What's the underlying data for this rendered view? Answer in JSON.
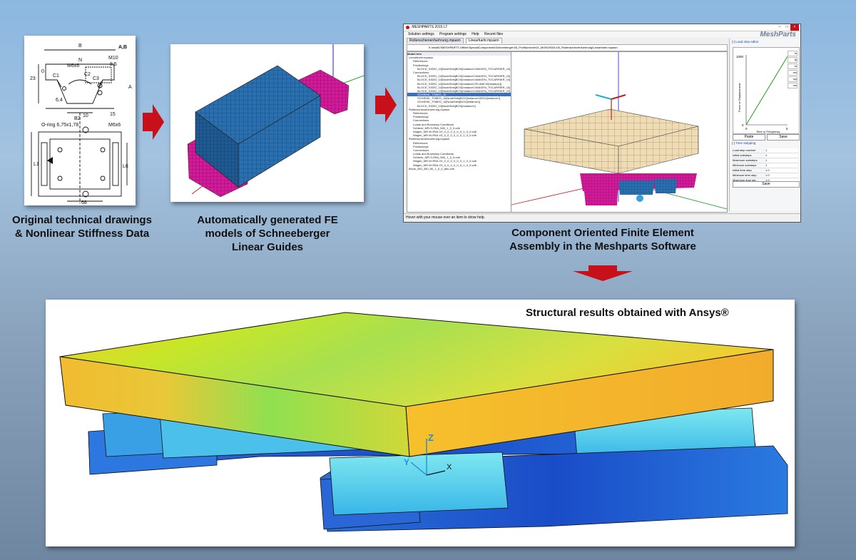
{
  "captions": {
    "drawings": [
      "Original technical drawings",
      "& Nonlinear Stiffness Data"
    ],
    "fe_models": [
      "Automatically generated FE",
      "models of Schneeberger",
      "Linear Guides"
    ],
    "assembly": [
      "Component Oriented Finite Element",
      "Assembly in the Meshparts Software"
    ],
    "results": "Structural results obtained with Ansys®"
  },
  "drawing": {
    "labels": [
      "B",
      "N",
      "A,B",
      "M10",
      "8,5",
      "M6x6",
      "23",
      "A",
      "0",
      "C1",
      "C2",
      "C3",
      "B2",
      "15",
      "6,4",
      "O-ring 6,75x1,78",
      "10",
      "M6x6",
      "L1",
      "L6",
      "68"
    ]
  },
  "meshparts_window": {
    "title": "MESHPARTS 2015 LT",
    "menu": [
      "Solution settings",
      "Program settings",
      "Help",
      "Recent files"
    ],
    "tabs": [
      "Rollenschienenfuehrung.mpasm",
      "Linearfuehr.mpasm"
    ],
    "path": "K:\\retail\\7\\MESHPARTS-Offline\\SpecialComponents\\Schneeberger\\05_Profilschiene\\01_MONORAIL\\05_Rollenschienenfuehrung\\Linearfuehr.mpasm",
    "logo": "MeshParts",
    "model_tree_title": "Model tree",
    "tree_items": [
      "Linearfuehr.mpasm",
      "References",
      "Positionings",
      "BLOCK_SIDE2_10[NodeSets]BOX[Instance1\\WAGEN_TOCARRIER_10]",
      "Connections",
      "BLOCK_SIDE2_10[NodeSets]BOX[Instance1\\WAGEN_TOCARRIER_10]",
      "BLOCK_SIDE2_10[NodeSets]BOX[Instance1\\WAGEN_TOCARRIER_10]",
      "BLOCK_SIDE2_10[NodeSets]BOX[Instance1\\PLANE10[Instance]]",
      "BLOCK_SIDE2_10[NodeSets]BOX[Instance1\\WAGEN_TOCARRIER_10]",
      "BLOCK_SIDE2_10[NodeSets]BOX[Instance1\\WAGEN_TOCARRIER_10]",
      "SCHIENE_TOBED_10",
      "SCHIENE_TOBED_10[NodeSets]BOX[Instance1\\BOX[Instance1]",
      "SCHIENE_TOBED_10[NodeSets]BOX[Instance1]",
      "BLOCK_SIDE2_10[NodeSets]BOX[Instance1]",
      "Rollenschienenfuehrung.mpasm",
      "References",
      "Positionings",
      "Connections",
      "Loads and Boundary Conditions",
      "Schiene_MR-S-R5A_560_1_0_0.cdb",
      "Wagen_MR-W-R5A-V3_0_0_0_0_0_0_1_0_0.cdb",
      "Wagen_MR-W-R5A-V3_0_0_0_0_0_0_1_0_0.cdb",
      "Rollenschienenfuehrung.mpasm",
      "References",
      "Positionings",
      "Connections",
      "Loads and Boundary Conditions",
      "Schiene_MR-S-R5A_560_1_0_0.cdb",
      "Wagen_MR-W-R5A-V3_0_0_0_0_0_0_1_0_0.cdb",
      "Wagen_MR-W-R5A-V3_0_0_0_0_0_0_1_0_0.cdb",
      "Block_450_450_50_1_0_0_abc.cdb"
    ],
    "load_step_editor": "[-] Load step editor",
    "plot": {
      "ymax": "1000",
      "ylabel": "Force or Displacement",
      "xlabel": "Time or Frequency",
      "xmin": "0",
      "xmax": "5",
      "ymin": "0"
    },
    "legend_items": [
      "fx",
      "fy",
      "fz",
      "mx",
      "my",
      "mz"
    ],
    "buttons": {
      "paste": "Paste",
      "save": "Save",
      "save2": "Save"
    },
    "time_stepping": "[-] Time stepping",
    "settings": [
      {
        "label": "Load step number",
        "value": "1"
      },
      {
        "label": "Initial substeps",
        "value": "1"
      },
      {
        "label": "Maximum substeps",
        "value": "1"
      },
      {
        "label": "Minimum substeps",
        "value": "1"
      },
      {
        "label": "Initial time step",
        "value": "1.0"
      },
      {
        "label": "Minimum time step",
        "value": "1.0"
      },
      {
        "label": "Maximum time ste...",
        "value": "1.0"
      }
    ],
    "status": "Hover with your mouse over an item to show help."
  },
  "results_view": {
    "axis_labels": [
      "Z",
      "Y",
      "X"
    ]
  },
  "colors": {
    "arrow": "#c8101a",
    "block_blue": "#2a6fb0",
    "block_magenta": "#d21a9a",
    "plate_tan": "#efdcb4"
  }
}
